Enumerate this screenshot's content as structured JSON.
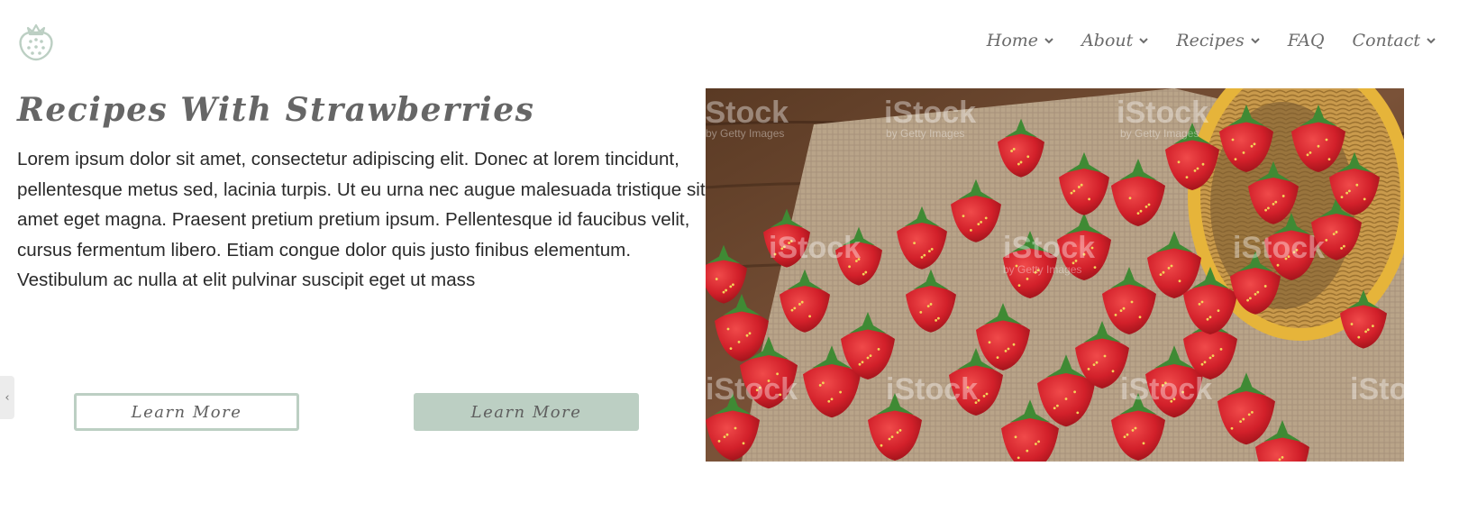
{
  "header": {
    "logo_icon": "strawberry-icon",
    "nav": [
      {
        "label": "Home",
        "has_dropdown": true
      },
      {
        "label": "About",
        "has_dropdown": true
      },
      {
        "label": "Recipes",
        "has_dropdown": true
      },
      {
        "label": "FAQ",
        "has_dropdown": false
      },
      {
        "label": "Contact",
        "has_dropdown": true
      }
    ]
  },
  "main": {
    "title": "Recipes With Strawberries",
    "paragraph": "Lorem ipsum dolor sit amet, consectetur adipiscing elit. Donec at lorem tincidunt, pellentesque metus sed, lacinia turpis. Ut eu urna nec augue malesuada tristique sit amet eget magna. Praesent pretium pretium ipsum. Pellentesque id faucibus velit, cursus fermentum libero. Etiam congue dolor quis justo finibus elementum. Vestibulum ac nulla at elit pulvinar suscipit eget ut mass",
    "buttons": [
      {
        "label": "Learn More",
        "style": "outline"
      },
      {
        "label": "Learn More",
        "style": "filled"
      }
    ]
  },
  "side_tab": {
    "icon": "chevron-left-icon",
    "glyph": "‹"
  },
  "hero_image": {
    "subject": "basket of strawberries",
    "watermark_brand": "iStock",
    "watermark_sub": "by Getty Images"
  },
  "colors": {
    "accent": "#bccfc3",
    "title": "#666666",
    "nav_text": "#6b6b6b",
    "body_text": "#2a2a2a"
  }
}
